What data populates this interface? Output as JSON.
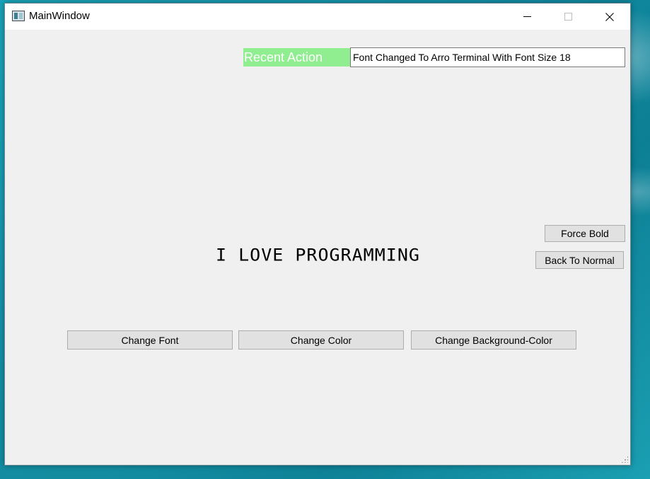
{
  "window": {
    "title": "MainWindow"
  },
  "recent_action": {
    "label": "Recent Action",
    "value": "Font Changed To Arro Terminal With Font Size 18"
  },
  "display": {
    "text": "I LOVE PROGRAMMING"
  },
  "buttons": {
    "force_bold": "Force Bold",
    "back_to_normal": "Back To Normal",
    "change_font": "Change Font",
    "change_color": "Change Color",
    "change_background_color": "Change Background-Color"
  },
  "colors": {
    "recent_label_bg": "#90ee90",
    "window_bg": "#f0f0f0",
    "button_bg": "#e1e1e1"
  },
  "icons": {
    "app": "app-window-icon",
    "minimize": "minimize-icon",
    "maximize": "maximize-icon",
    "close": "close-icon",
    "grip": "resize-grip-icon"
  }
}
